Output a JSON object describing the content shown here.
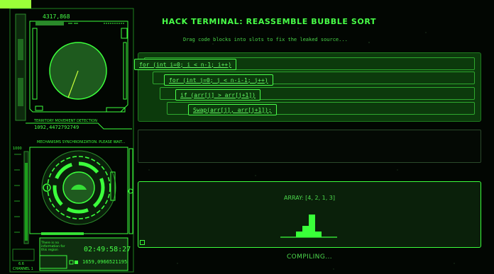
{
  "hud": {
    "top_number": "4317,868",
    "motion_label": "TERRITORY MOVEMENT DETECTION",
    "motion_value": "1092,4472792749",
    "sync_label": "MECHANISMS SYNCHRONIZATION. PLEASE WAIT...",
    "scale_top": "1000",
    "no_info": "There is no information for this region",
    "clock": "02:49:58:27",
    "coords": "1659,0966521195",
    "channel_value": "6.6",
    "channel_label": "CHANNEL 1"
  },
  "header": {
    "title": "HACK TERMINAL: REASSEMBLE BUBBLE SORT",
    "subtitle": "Drag code blocks into slots to fix the leaked source..."
  },
  "code_blocks": [
    {
      "text": "for (int i=0; i < n-1; i++)"
    },
    {
      "text": "for (int j=0; j < n-i-1; j++)"
    },
    {
      "text": "if (arr[j] > arr[j+1])"
    },
    {
      "text": "Swap(arr[j], arr[j+1]);"
    }
  ],
  "visualizer": {
    "array_label": "ARRAY: [4, 2, 1, 3]",
    "bars": [
      1,
      2,
      4,
      1
    ],
    "status": "COMPILING..."
  },
  "colors": {
    "accent": "#3cff3c",
    "panel": "#0c3a0c",
    "corner": "#9bff39"
  }
}
